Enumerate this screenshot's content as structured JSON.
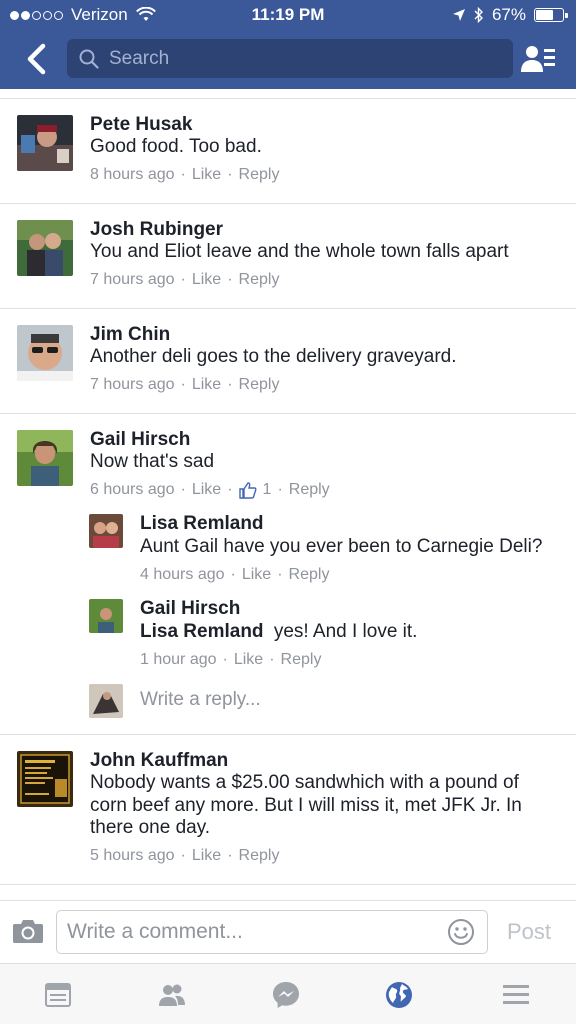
{
  "status_bar": {
    "carrier": "Verizon",
    "time": "11:19 PM",
    "battery": "67%",
    "battery_level": 0.67
  },
  "header": {
    "search_placeholder": "Search"
  },
  "comments": [
    {
      "name": "Pete Husak",
      "text": "Good food. Too bad.",
      "time": "8 hours ago",
      "like": "Like",
      "reply": "Reply"
    },
    {
      "name": "Josh Rubinger",
      "text": "You and Eliot leave and the whole town falls apart",
      "time": "7 hours ago",
      "like": "Like",
      "reply": "Reply"
    },
    {
      "name": "Jim Chin",
      "text": "Another deli goes to the delivery graveyard.",
      "time": "7 hours ago",
      "like": "Like",
      "reply": "Reply"
    },
    {
      "name": "Gail Hirsch",
      "text": "Now that's sad",
      "time": "6 hours ago",
      "like": "Like",
      "like_count": "1",
      "reply": "Reply",
      "replies": [
        {
          "name": "Lisa Remland",
          "text": "Aunt Gail have you ever been to Carnegie Deli?",
          "time": "4 hours ago",
          "like": "Like",
          "reply": "Reply"
        },
        {
          "name": "Gail Hirsch",
          "mention": "Lisa Remland",
          "text": "yes!  And I love it.",
          "time": "1 hour ago",
          "like": "Like",
          "reply": "Reply"
        }
      ],
      "write_reply": "Write a reply..."
    },
    {
      "name": "John Kauffman",
      "text_lines": [
        "Nobody wants a $25.00 sandwhich with a pound of",
        "corn beef any more. But I will miss it, met JFK Jr. In",
        "there one day."
      ],
      "time": "5 hours ago",
      "like": "Like",
      "reply": "Reply"
    }
  ],
  "composer": {
    "placeholder": "Write a comment...",
    "post_label": "Post"
  },
  "tabbar": {
    "icons": [
      "news-feed-icon",
      "friends-icon",
      "messenger-icon",
      "globe-icon",
      "menu-icon"
    ],
    "active": "globe-icon"
  },
  "colors": {
    "header_bg": "#3b5998",
    "search_bg": "#2d4373",
    "meta_text": "#90949c",
    "active_tab": "#4267b2"
  }
}
